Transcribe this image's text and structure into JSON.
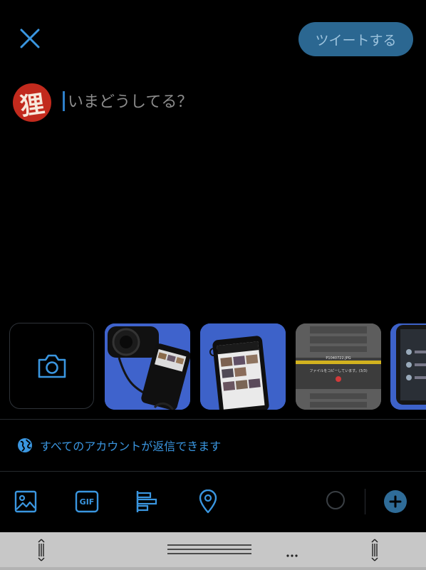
{
  "header": {
    "tweet_button_label": "ツイートする"
  },
  "avatar": {
    "glyph": "狸"
  },
  "composer": {
    "placeholder": "いまどうしてる？",
    "value": ""
  },
  "media": {
    "thumbnails": [
      {
        "photo": "camera-and-phone-on-blue-cloth"
      },
      {
        "photo": "phone-showing-gallery-on-blue-cloth"
      },
      {
        "photo": "phone-file-copy-dialog"
      },
      {
        "photo": "phone-settings-screen"
      }
    ],
    "copy_dialog": {
      "filename": "P1040722.JPG",
      "message": "ファイルをコピーしています。(3/3)"
    }
  },
  "reply_setting": {
    "label": "すべてのアカウントが返信できます"
  },
  "toolbar": {
    "gif_label": "GIF"
  },
  "colors": {
    "accent": "#3a96e0",
    "tweet_button_bg": "#2b6791",
    "background": "#000000"
  }
}
